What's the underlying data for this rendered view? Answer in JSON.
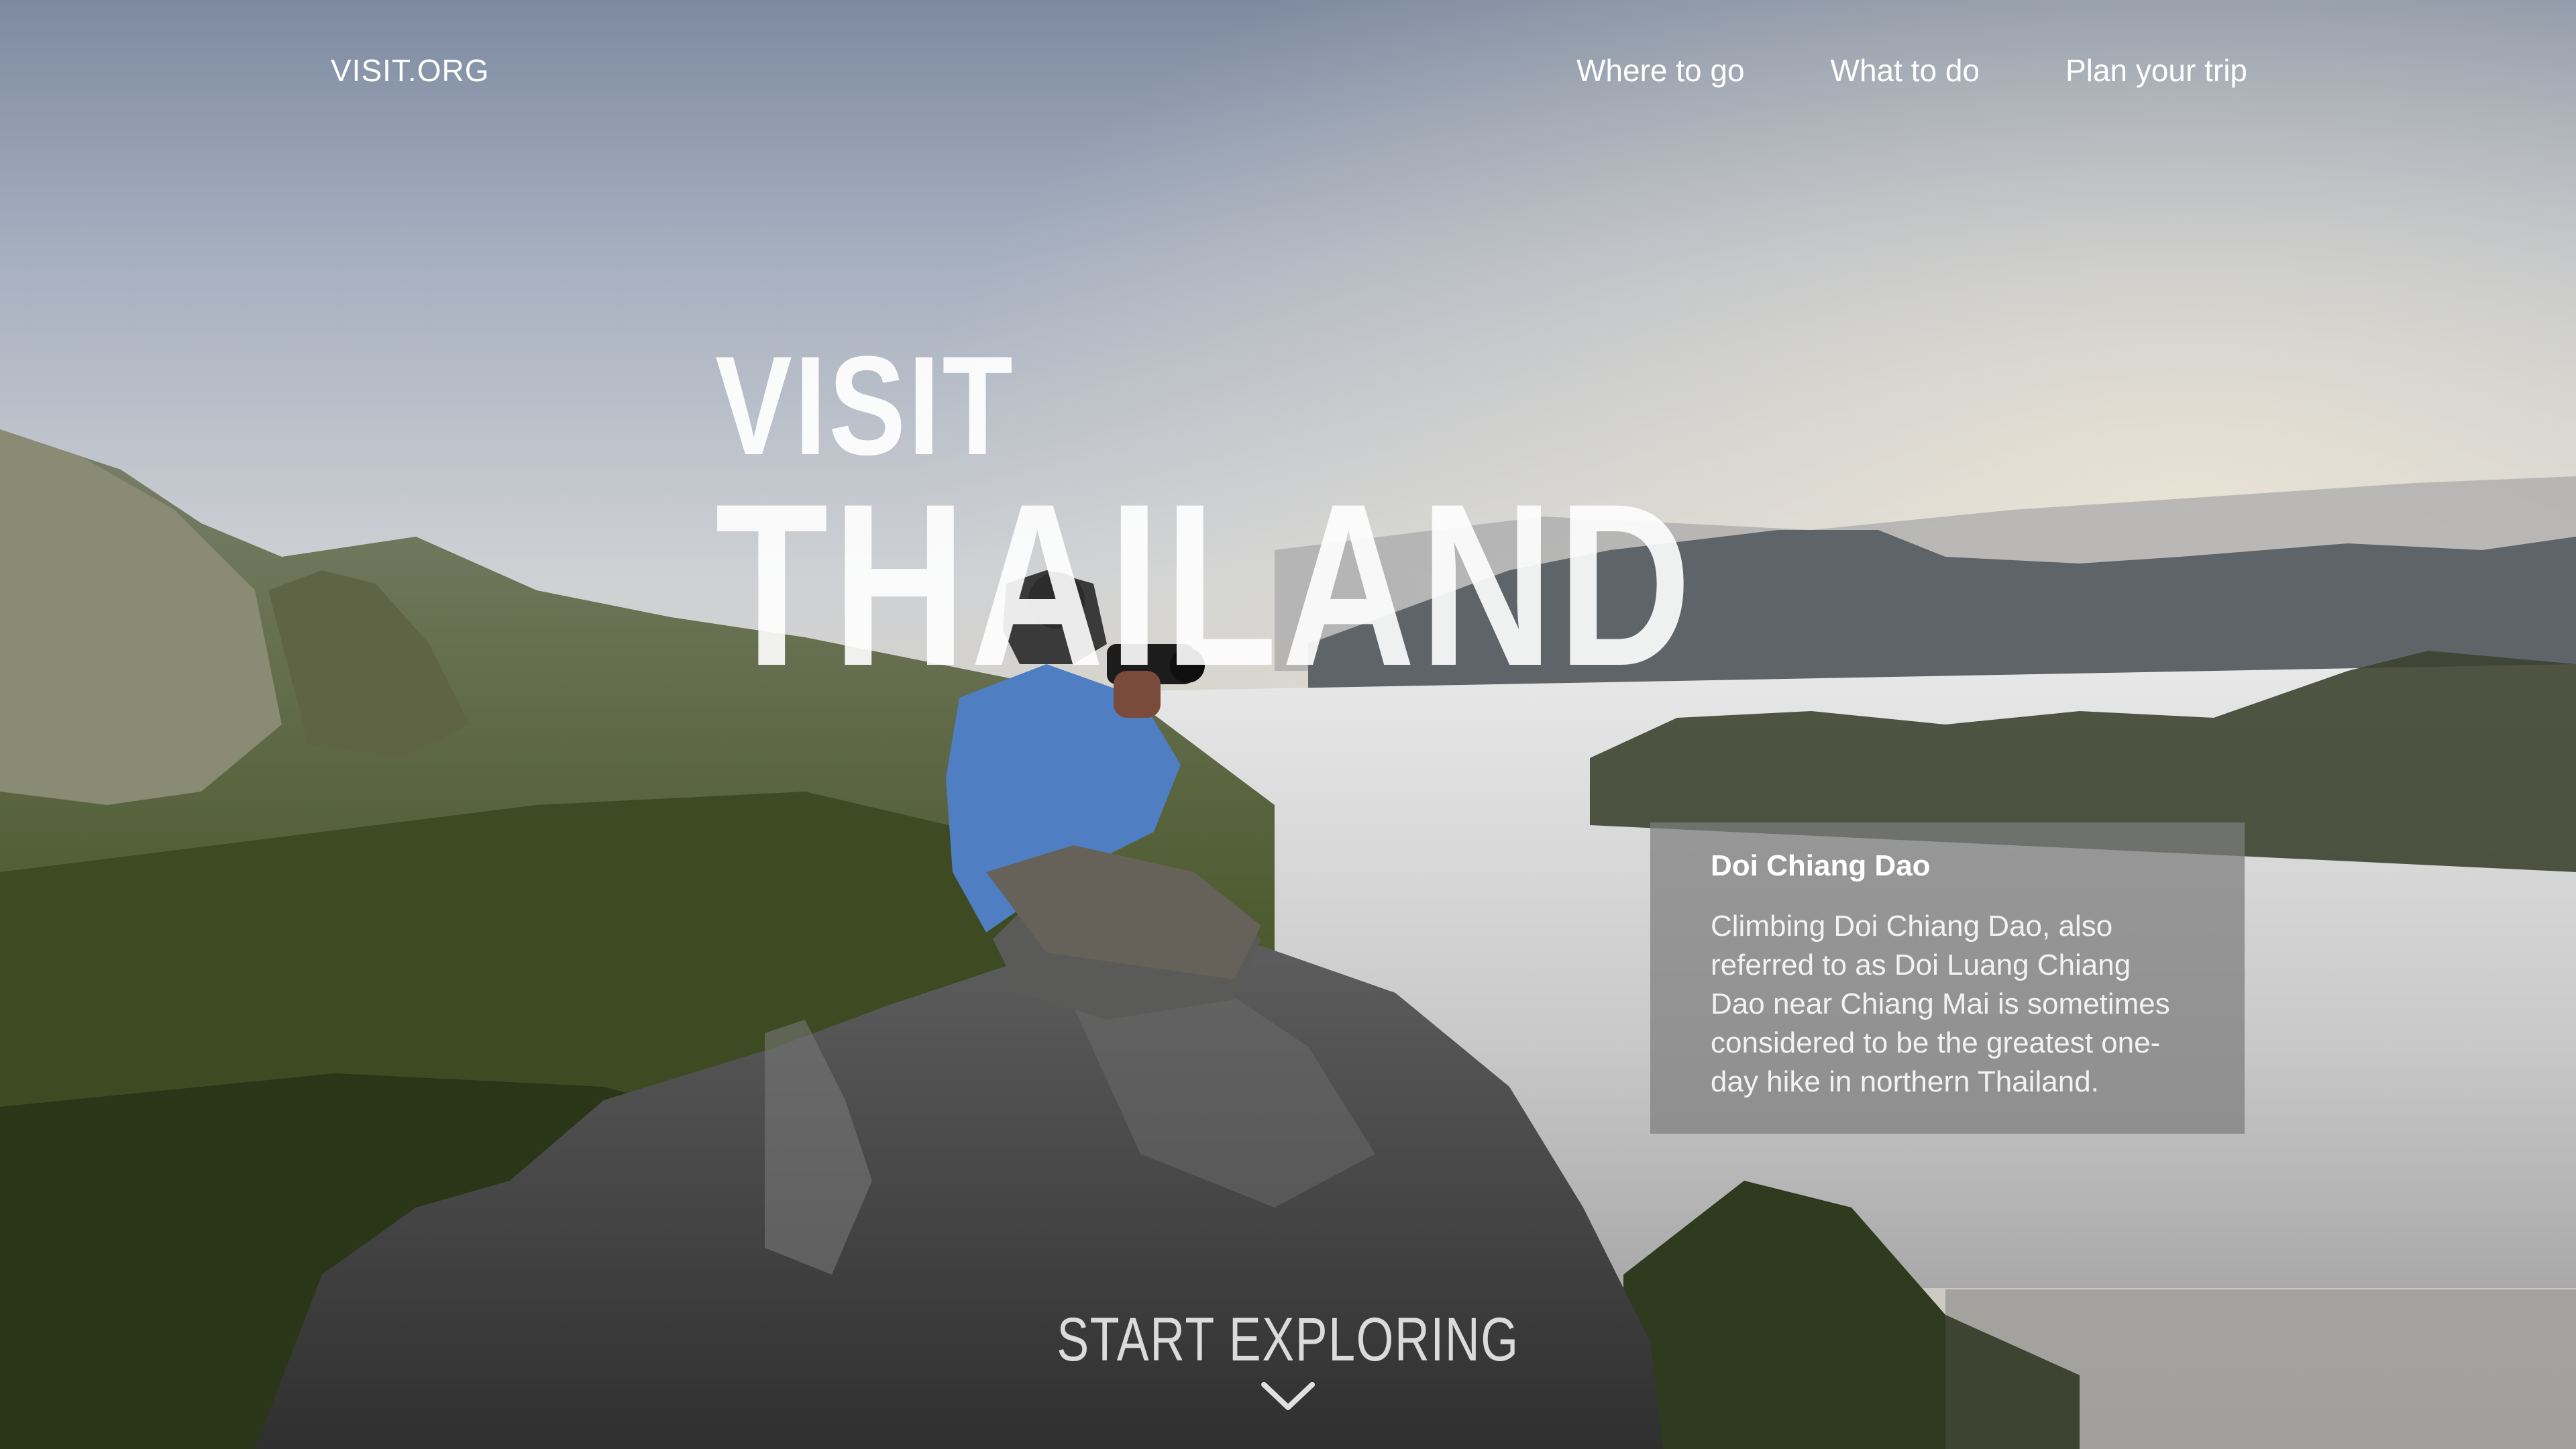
{
  "nav": {
    "brand": "VISIT.ORG",
    "links": [
      "Where to go",
      "What to do",
      "Plan your trip"
    ]
  },
  "hero": {
    "line1": "VISIT",
    "line2": "THAILAND"
  },
  "info_card": {
    "title": "Doi Chiang Dao",
    "body": "Climbing Doi Chiang Dao, also referred to as Doi Luang Chiang Dao near Chiang Mai is sometimes considered to be the greatest one-day hike in northern Thailand."
  },
  "cta": {
    "label": "START EXPLORING",
    "icon": "chevron-down-icon"
  },
  "background": {
    "image": "photographer-on-mountain-peak-above-clouds-photo",
    "sky_color": "#c9cfd6",
    "jacket_color": "#4f7fc2"
  }
}
